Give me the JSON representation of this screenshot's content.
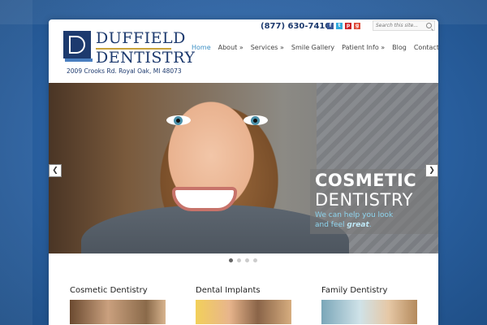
{
  "header": {
    "logo_line1": "DUFFIELD",
    "logo_line2": "DENTISTRY",
    "address": "2009 Crooks Rd. Royal Oak, MI 48073",
    "phone": "(877) 630-7410",
    "social": [
      {
        "name": "facebook-icon",
        "glyph": "f"
      },
      {
        "name": "twitter-icon",
        "glyph": "t"
      },
      {
        "name": "pinterest-icon",
        "glyph": "p"
      },
      {
        "name": "google-plus-icon",
        "glyph": "g"
      }
    ],
    "search_placeholder": "Search this site..."
  },
  "nav": {
    "items": [
      {
        "label": "Home",
        "active": true
      },
      {
        "label": "About »",
        "active": false
      },
      {
        "label": "Services »",
        "active": false
      },
      {
        "label": "Smile Gallery",
        "active": false
      },
      {
        "label": "Patient Info »",
        "active": false
      },
      {
        "label": "Blog",
        "active": false
      },
      {
        "label": "Contact",
        "active": false
      }
    ]
  },
  "hero": {
    "title1": "COSMETIC",
    "title2": "DENTISTRY",
    "tagline1": "We can help you look",
    "tagline2_prefix": "and feel ",
    "tagline2_em": "great",
    "tagline2_suffix": ".",
    "prev": "❮",
    "next": "❯",
    "slide_count": 4,
    "active_slide": 1
  },
  "services": [
    {
      "title": "Cosmetic Dentistry"
    },
    {
      "title": "Dental Implants"
    },
    {
      "title": "Family Dentistry"
    }
  ],
  "colors": {
    "brand_navy": "#1d3a6e",
    "nav_active": "#3b8fc4",
    "background_blue": "#2a5f9c",
    "caption_blue": "#8ed4ee"
  }
}
